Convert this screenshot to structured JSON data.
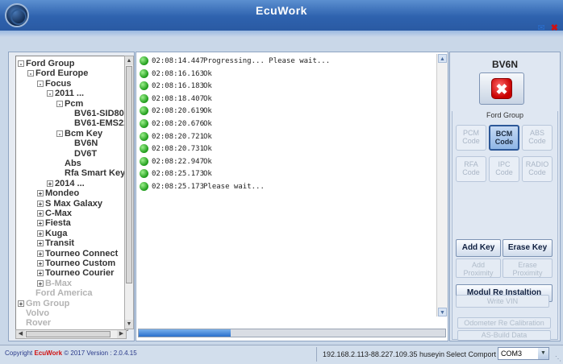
{
  "window": {
    "title": "EcuWork"
  },
  "tree": {
    "items": [
      {
        "label": "Ford Group",
        "expander": "-",
        "dim": false
      },
      {
        "label": "Ford Europe",
        "expander": "-",
        "dim": false
      },
      {
        "label": "Focus",
        "expander": "-",
        "dim": false
      },
      {
        "label": "2011 ...",
        "expander": "-",
        "dim": false
      },
      {
        "label": "Pcm",
        "expander": "-",
        "dim": false
      },
      {
        "label": "BV61-SID80",
        "expander": "",
        "dim": false
      },
      {
        "label": "BV61-EMS22",
        "expander": "",
        "dim": false
      },
      {
        "label": "Bcm Key",
        "expander": "-",
        "dim": false
      },
      {
        "label": "BV6N",
        "expander": "",
        "dim": false
      },
      {
        "label": "DV6T",
        "expander": "",
        "dim": false
      },
      {
        "label": "Abs",
        "expander": "",
        "dim": false
      },
      {
        "label": "Rfa Smart Key",
        "expander": "",
        "dim": false
      },
      {
        "label": "2014 ...",
        "expander": "+",
        "dim": false
      },
      {
        "label": "Mondeo",
        "expander": "+",
        "dim": false
      },
      {
        "label": "S Max Galaxy",
        "expander": "+",
        "dim": false
      },
      {
        "label": "C-Max",
        "expander": "+",
        "dim": false
      },
      {
        "label": "Fiesta",
        "expander": "+",
        "dim": false
      },
      {
        "label": "Kuga",
        "expander": "+",
        "dim": false
      },
      {
        "label": "Transit",
        "expander": "+",
        "dim": false
      },
      {
        "label": "Tourneo Connect",
        "expander": "+",
        "dim": false
      },
      {
        "label": "Tourneo Custom",
        "expander": "+",
        "dim": false
      },
      {
        "label": "Tourneo Courier",
        "expander": "+",
        "dim": false
      },
      {
        "label": "B-Max",
        "expander": "+",
        "dim": true
      },
      {
        "label": "Ford America",
        "expander": "",
        "dim": true
      },
      {
        "label": "Gm Group",
        "expander": "+",
        "dim": true
      },
      {
        "label": "Volvo",
        "expander": "",
        "dim": true
      },
      {
        "label": "Rover",
        "expander": "",
        "dim": true
      }
    ]
  },
  "log": {
    "entries": [
      {
        "time": "02:08:14.447",
        "message": "Progressing... Please wait..."
      },
      {
        "time": "02:08:16.163",
        "message": "Ok"
      },
      {
        "time": "02:08:16.183",
        "message": "Ok"
      },
      {
        "time": "02:08:18.407",
        "message": "Ok"
      },
      {
        "time": "02:08:20.619",
        "message": "Ok"
      },
      {
        "time": "02:08:20.676",
        "message": "Ok"
      },
      {
        "time": "02:08:20.721",
        "message": "Ok"
      },
      {
        "time": "02:08:20.731",
        "message": "Ok"
      },
      {
        "time": "02:08:22.947",
        "message": "Ok"
      },
      {
        "time": "02:08:25.173",
        "message": "Ok"
      },
      {
        "time": "02:08:25.173",
        "message": "Please wait..."
      }
    ],
    "progress": 0.3
  },
  "panel": {
    "ecu_name": "BV6N",
    "group_label": "Ford Group",
    "code_buttons": [
      {
        "line1": "PCM",
        "line2": "Code",
        "active": false
      },
      {
        "line1": "BCM",
        "line2": "Code",
        "active": true
      },
      {
        "line1": "ABS",
        "line2": "Code",
        "active": false
      },
      {
        "line1": "RFA",
        "line2": "Code",
        "active": false
      },
      {
        "line1": "IPC",
        "line2": "Code",
        "active": false
      },
      {
        "line1": "RADIO",
        "line2": "Code",
        "active": false
      }
    ],
    "add_key": "Add Key",
    "erase_key": "Erase Key",
    "add_proximity_1": "Add",
    "add_proximity_2": "Proximity",
    "erase_proximity_1": "Erase",
    "erase_proximity_2": "Proximity",
    "modul_re_install": "Modul Re Instaltion",
    "odometer": "Odometer Re Calibration",
    "as_build": "AS-Build Data",
    "write_vin": "Write VIN"
  },
  "status": {
    "copyright_prefix": "Copyright",
    "copyright_brand": "EcuWork",
    "copyright_suffix": "© 2017 Version : 2.0.4.15",
    "ip": "192.168.2.113-88.227.109.35  huseyin",
    "comport_label": "Select Comport :",
    "comport_value": "COM3"
  },
  "colors": {
    "accent": "#2e62ae",
    "ok_green": "#1c9a18",
    "stop_red": "#c80000"
  }
}
